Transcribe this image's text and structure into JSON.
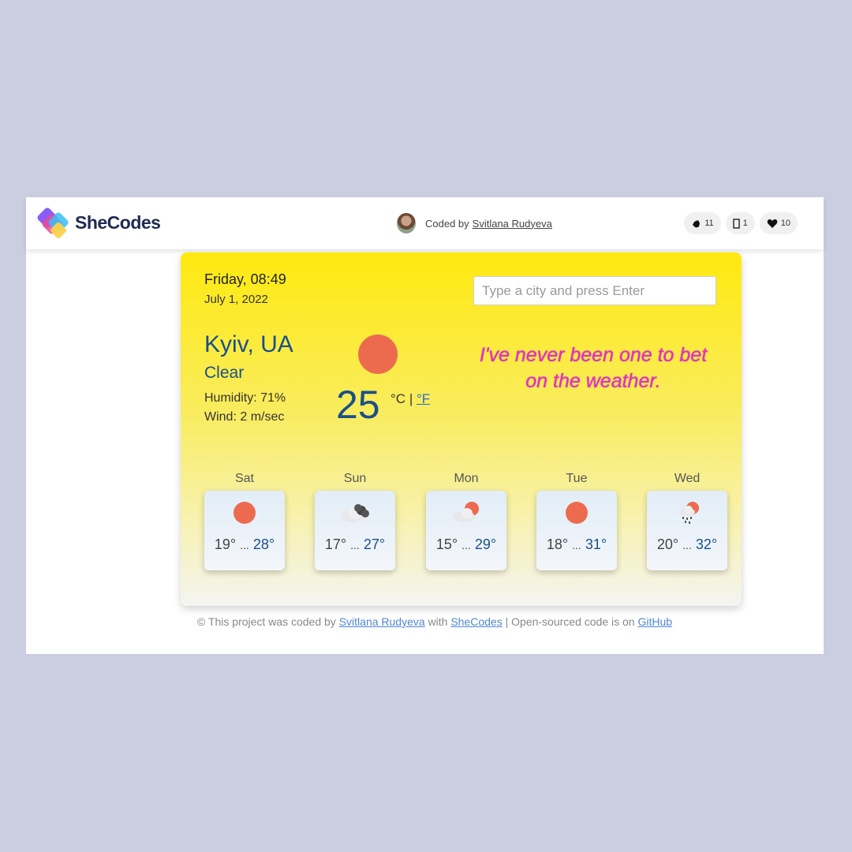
{
  "header": {
    "logo_text": "SheCodes",
    "coded_by_prefix": "Coded by",
    "author_name": "Svitlana Rudyeva",
    "stats": [
      {
        "icon": "clap-icon",
        "count": "11"
      },
      {
        "icon": "bookmark-icon",
        "count": "1"
      },
      {
        "icon": "heart-icon",
        "count": "10"
      }
    ]
  },
  "weather": {
    "day_time": "Friday, 08:49",
    "date": "July 1, 2022",
    "search_placeholder": "Type a city and press Enter",
    "city": "Kyiv, UA",
    "description": "Clear",
    "humidity": "Humidity: 71%",
    "wind": "Wind: 2 m/sec",
    "temperature": "25",
    "unit_c": "°C",
    "unit_sep": "|",
    "unit_f": "°F",
    "icon": "sun-icon",
    "quote_line1": "I've never been one to bet",
    "quote_line2": "on the weather."
  },
  "forecast": [
    {
      "day": "Sat",
      "min": "19°",
      "sep": "...",
      "max": "28°",
      "icon": "sun-icon"
    },
    {
      "day": "Sun",
      "min": "17°",
      "sep": "...",
      "max": "27°",
      "icon": "cloudy-icon"
    },
    {
      "day": "Mon",
      "min": "15°",
      "sep": "...",
      "max": "29°",
      "icon": "partly-cloudy-icon"
    },
    {
      "day": "Tue",
      "min": "18°",
      "sep": "...",
      "max": "31°",
      "icon": "sun-icon"
    },
    {
      "day": "Wed",
      "min": "20°",
      "sep": "...",
      "max": "32°",
      "icon": "rain-sun-icon"
    }
  ],
  "footer": {
    "prefix": "© This project was coded by",
    "author": "Svitlana Rudyeva",
    "with": "with",
    "shecodes": "SheCodes",
    "middle": "| Open-sourced code is on",
    "github": "GitHub"
  },
  "colors": {
    "background": "#cbcee0",
    "card_top": "#ffe90f",
    "accent_blue": "#1a4f8a",
    "quote": "#e92bd3",
    "sun": "#ec6b4e"
  }
}
